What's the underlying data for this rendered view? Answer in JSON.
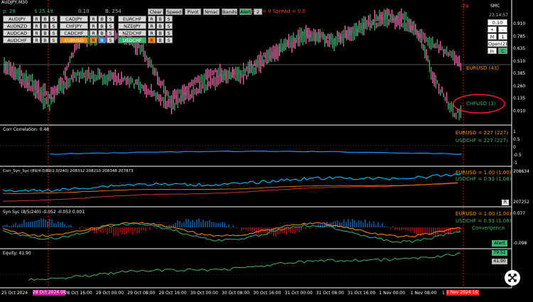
{
  "header": {
    "symbol_tf": "AUDJPY,M30",
    "p_label": "p: 28",
    "pnl": "$ 25.49",
    "lot": "0.10",
    "b_count": "B: 254",
    "open_spread": "Open = 0   Spread = 0.0",
    "close_marker": "-74"
  },
  "toolbar": {
    "buttons": [
      "Clear",
      "Speed",
      "Pivot",
      "Nmac",
      "Bands",
      "Alert",
      "2"
    ]
  },
  "symbol_table": {
    "rows": [
      [
        {
          "sym": "AUDJPY",
          "c": [
            "R",
            "B",
            "S"
          ]
        },
        {
          "sym": "CADJPY",
          "c": [
            "R",
            "B",
            "S"
          ]
        },
        {
          "sym": "EURCHF",
          "c": [
            "R",
            "B",
            "S"
          ]
        }
      ],
      [
        {
          "sym": "AUDNZD",
          "c": [
            "R",
            "B",
            "S"
          ]
        },
        {
          "sym": "CHFJPY",
          "c": [
            "R",
            "B",
            "S"
          ]
        },
        {
          "sym": "NZDJPY",
          "c": [
            "R",
            "B",
            "S"
          ]
        }
      ],
      [
        {
          "sym": "AUDCAD",
          "c": [
            "R",
            "B",
            "S"
          ]
        },
        {
          "sym": "CADCHF",
          "c": [
            "R",
            "B",
            "S"
          ]
        },
        {
          "sym": "NZDCHF",
          "c": [
            "R",
            "B",
            "S"
          ]
        }
      ],
      [
        {
          "sym": "AUDCHF",
          "c": [
            "R",
            "B",
            "S"
          ]
        },
        {
          "sym": "EURUSD",
          "c": [
            "R",
            "B",
            "S"
          ]
        },
        {
          "sym": "USDCHF",
          "c": [
            "R",
            "B",
            "S"
          ]
        }
      ]
    ]
  },
  "side_panel": {
    "logo": "SMC",
    "time": "23:14:57",
    "lot_value": "0.10",
    "plus": "+",
    "minus": "-",
    "m_label": "M",
    "m_value": "1",
    "open_label": "Open(2)",
    "in_label": "In",
    "c_label": "C"
  },
  "main_chart": {
    "price_labels": [
      "0.910",
      "0.785",
      "0.635",
      "0.510",
      "0.385",
      "0.260",
      "0.135",
      "0.010"
    ],
    "eurusd_label": "EURUSD (43)",
    "chfusd_label": "CHFUSD (3)"
  },
  "corr_panel": {
    "title": "Corr Correlation: 0.48",
    "eurusd_text": "EURUSD = 227 (227)",
    "usdchf_text": "USDCHF = 227 (227)",
    "axis": [
      "1",
      "0.5",
      "0",
      "-0.5",
      "-1"
    ]
  },
  "syn_panel": {
    "title": "Corr_Syn_Syc (89/4.0/89/2.0/240) 208312 208210 208348 207873",
    "eurusd_text": "EURUSD = 1.00 (1.00)",
    "usdchf_text": "USDCHF = 0.93 (1.08)",
    "axis_top": "208634",
    "axis_bot": "207252",
    "r_box": "R"
  },
  "osc_panel": {
    "title": "Syn Syc (8/5/240) -0.052 -0.053 0.001",
    "eurusd_text": "EURUSD = 1.00 (1.00)",
    "usdchf_text": "USDCHF = 0.93 (1.08)",
    "convergence": "Convergence",
    "alert": "Alert",
    "axis_top": "0.077",
    "axis_bot": "-0.098"
  },
  "equity_panel": {
    "title": "Equity: 41.90",
    "value_green": "79.51",
    "value_grey": "41.90"
  },
  "time_axis": {
    "labels": [
      "25 Oct 2024",
      "28 Oct 08:00",
      "28 Oct 16:00",
      "29 Oct 00:00",
      "29 Oct 08:00",
      "29 Oct 16:00",
      "30 Oct 00:00",
      "30 Oct 08:00",
      "30 Oct 16:00",
      "31 Oct 00:00",
      "31 Oct 08:00",
      "31 Oct 16:00",
      "1 Nov 00:00",
      "1 Nov 08:00",
      "1 N"
    ],
    "hl_left": "28 Oct 2024 08:00",
    "hl_right": "1 Nov 2024 16:00"
  },
  "colors": {
    "bull": "#3cb371",
    "bear": "#ff69b4",
    "blue": "#1e90ff",
    "orange": "#ff8c00",
    "red_marker": "#ff2020"
  }
}
